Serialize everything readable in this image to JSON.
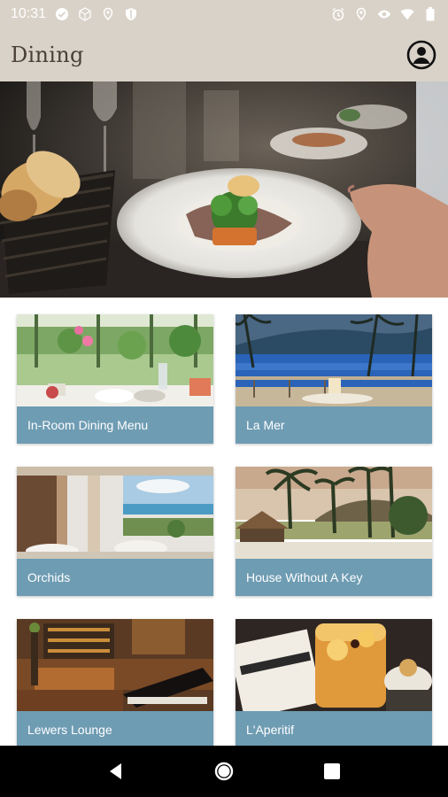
{
  "status_bar": {
    "time": "10:31",
    "left_icons": [
      "check-circle-icon",
      "cube-icon",
      "location-pin-icon",
      "shield-icon"
    ],
    "right_icons": [
      "alarm-icon",
      "location-icon",
      "eye-icon",
      "wifi-icon",
      "battery-icon"
    ]
  },
  "app_bar": {
    "title": "Dining",
    "profile_icon": "account-circle-icon"
  },
  "hero": {
    "image": "fine-dining-plate-photo"
  },
  "restaurants": [
    {
      "label": "In-Room Dining Menu"
    },
    {
      "label": "La Mer"
    },
    {
      "label": "Orchids"
    },
    {
      "label": "House Without A Key"
    },
    {
      "label": "Lewers Lounge"
    },
    {
      "label": "L'Aperitif"
    }
  ],
  "nav_bar": {
    "buttons": [
      "back-icon",
      "home-icon",
      "recents-icon"
    ]
  },
  "colors": {
    "app_bar_bg": "#d9d2c8",
    "title_text": "#4a4038",
    "card_label_bg": "#6e9cb3",
    "nav_bar_bg": "#000000"
  }
}
